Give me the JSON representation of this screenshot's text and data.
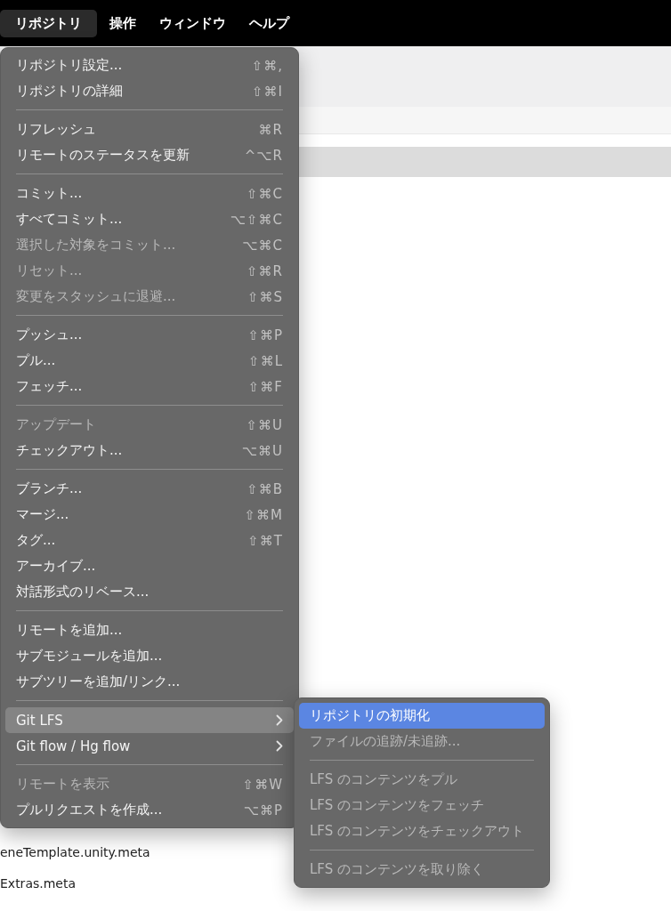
{
  "menubar": [
    {
      "label": "リポジトリ",
      "selected": true
    },
    {
      "label": "操作",
      "selected": false
    },
    {
      "label": "ウィンドウ",
      "selected": false
    },
    {
      "label": "ヘルプ",
      "selected": false
    }
  ],
  "file_list": [
    {
      "name": "eneTemplate.unity.meta"
    },
    {
      "name": "Extras.meta"
    }
  ],
  "menu": {
    "groups": [
      [
        {
          "label": "リポジトリ設定...",
          "shortcut": "⇧⌘,",
          "disabled": false,
          "selected": false,
          "submenu": false
        },
        {
          "label": "リポジトリの詳細",
          "shortcut": "⇧⌘I",
          "disabled": false,
          "selected": false,
          "submenu": false
        }
      ],
      [
        {
          "label": "リフレッシュ",
          "shortcut": "⌘R",
          "disabled": false,
          "selected": false,
          "submenu": false
        },
        {
          "label": "リモートのステータスを更新",
          "shortcut": "^⌥R",
          "disabled": false,
          "selected": false,
          "submenu": false
        }
      ],
      [
        {
          "label": "コミット...",
          "shortcut": "⇧⌘C",
          "disabled": false,
          "selected": false,
          "submenu": false
        },
        {
          "label": "すべてコミット...",
          "shortcut": "⌥⇧⌘C",
          "disabled": false,
          "selected": false,
          "submenu": false
        },
        {
          "label": "選択した対象をコミット...",
          "shortcut": "⌥⌘C",
          "disabled": true,
          "selected": false,
          "submenu": false
        },
        {
          "label": "リセット...",
          "shortcut": "⇧⌘R",
          "disabled": true,
          "selected": false,
          "submenu": false
        },
        {
          "label": "変更をスタッシュに退避...",
          "shortcut": "⇧⌘S",
          "disabled": true,
          "selected": false,
          "submenu": false
        }
      ],
      [
        {
          "label": "プッシュ...",
          "shortcut": "⇧⌘P",
          "disabled": false,
          "selected": false,
          "submenu": false
        },
        {
          "label": "プル...",
          "shortcut": "⇧⌘L",
          "disabled": false,
          "selected": false,
          "submenu": false
        },
        {
          "label": "フェッチ...",
          "shortcut": "⇧⌘F",
          "disabled": false,
          "selected": false,
          "submenu": false
        }
      ],
      [
        {
          "label": "アップデート",
          "shortcut": "⇧⌘U",
          "disabled": true,
          "selected": false,
          "submenu": false
        },
        {
          "label": "チェックアウト...",
          "shortcut": "⌥⌘U",
          "disabled": false,
          "selected": false,
          "submenu": false
        }
      ],
      [
        {
          "label": "ブランチ...",
          "shortcut": "⇧⌘B",
          "disabled": false,
          "selected": false,
          "submenu": false
        },
        {
          "label": "マージ...",
          "shortcut": "⇧⌘M",
          "disabled": false,
          "selected": false,
          "submenu": false
        },
        {
          "label": "タグ...",
          "shortcut": "⇧⌘T",
          "disabled": false,
          "selected": false,
          "submenu": false
        },
        {
          "label": "アーカイブ...",
          "disabled": false,
          "selected": false,
          "submenu": false
        },
        {
          "label": "対話形式のリベース...",
          "disabled": false,
          "selected": false,
          "submenu": false
        }
      ],
      [
        {
          "label": "リモートを追加...",
          "disabled": false,
          "selected": false,
          "submenu": false
        },
        {
          "label": "サブモジュールを追加...",
          "disabled": false,
          "selected": false,
          "submenu": false
        },
        {
          "label": "サブツリーを追加/リンク...",
          "disabled": false,
          "selected": false,
          "submenu": false
        }
      ],
      [
        {
          "label": "Git LFS",
          "disabled": false,
          "selected": true,
          "submenu": true
        },
        {
          "label": "Git flow / Hg flow",
          "disabled": false,
          "selected": false,
          "submenu": true
        }
      ],
      [
        {
          "label": "リモートを表示",
          "shortcut": "⇧⌘W",
          "disabled": true,
          "selected": false,
          "submenu": false
        },
        {
          "label": "プルリクエストを作成...",
          "shortcut": "⌥⌘P",
          "disabled": false,
          "selected": false,
          "submenu": false
        }
      ]
    ]
  },
  "submenu": {
    "groups": [
      [
        {
          "label": "リポジトリの初期化",
          "disabled": false,
          "selected": true
        },
        {
          "label": "ファイルの追跡/未追跡...",
          "disabled": true,
          "selected": false
        }
      ],
      [
        {
          "label": "LFS のコンテンツをプル",
          "disabled": true,
          "selected": false
        },
        {
          "label": "LFS のコンテンツをフェッチ",
          "disabled": true,
          "selected": false
        },
        {
          "label": "LFS のコンテンツをチェックアウト",
          "disabled": true,
          "selected": false
        }
      ],
      [
        {
          "label": "LFS のコンテンツを取り除く",
          "disabled": true,
          "selected": false
        }
      ]
    ]
  }
}
